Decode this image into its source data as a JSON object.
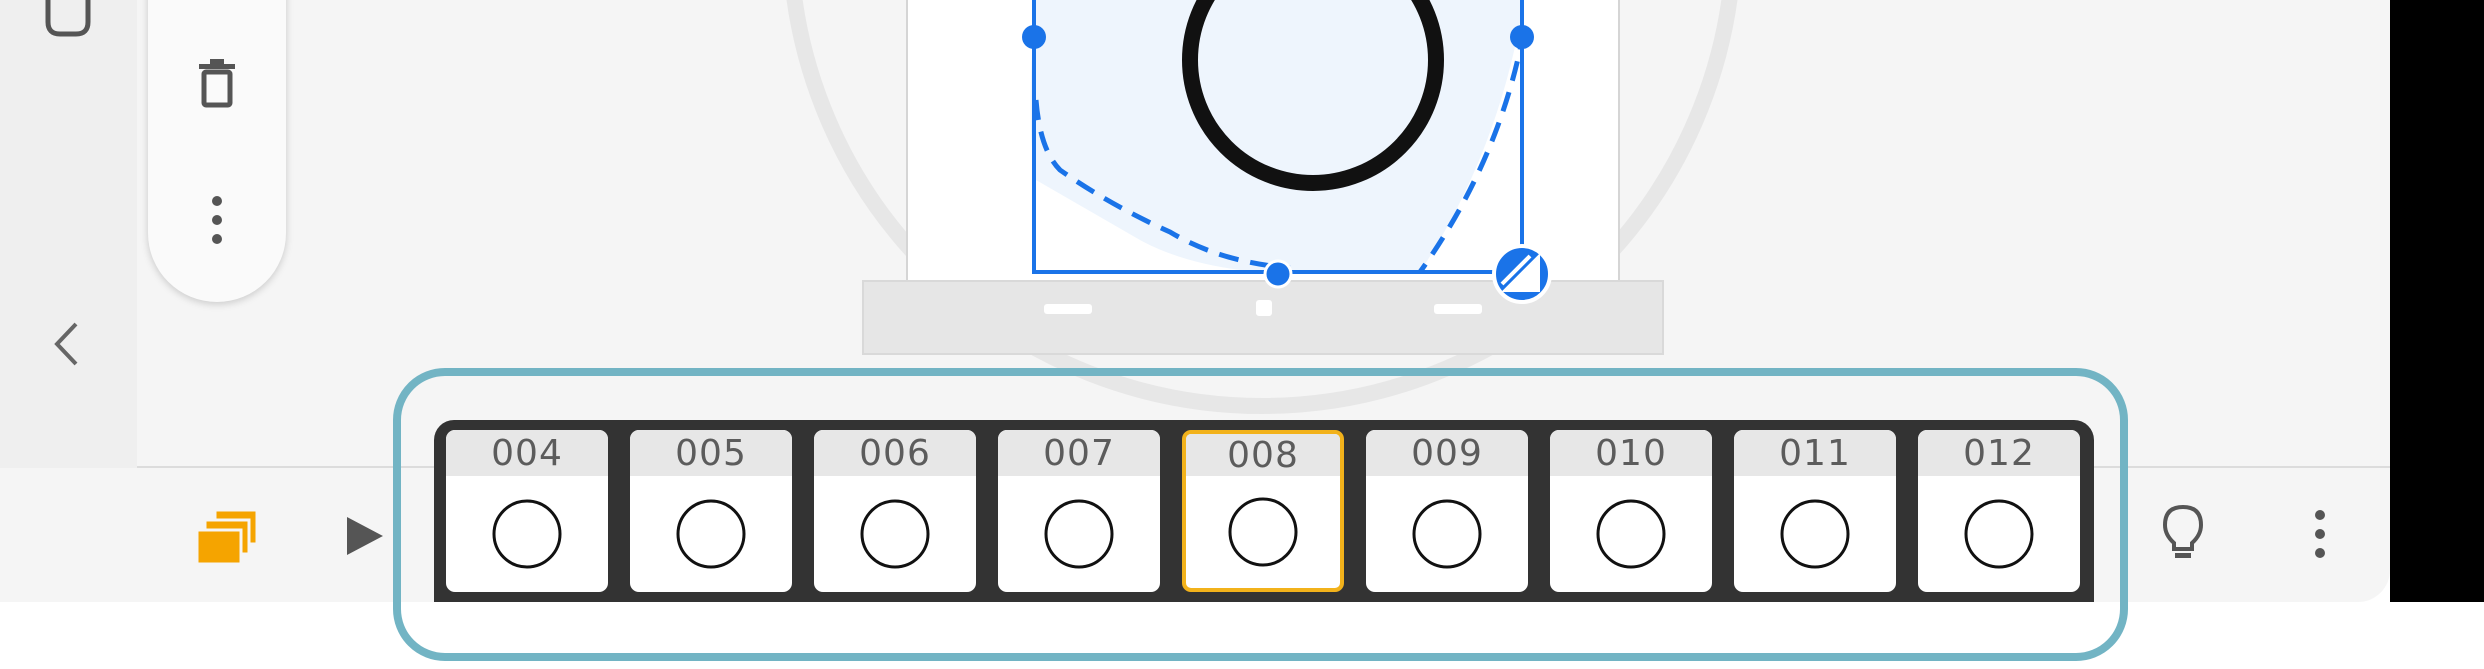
{
  "colors": {
    "accent_blue": "#1a73e8",
    "selection_fill": "#eef5fd",
    "frame_selected_border": "#f2b21b",
    "highlight_outline": "#72b4c4",
    "strip_background": "#333333",
    "layers_icon": "#f5a400"
  },
  "left_panel": {
    "icons": [
      "square-icon",
      "trash-icon",
      "more-vertical-icon",
      "chevron-left-icon"
    ]
  },
  "canvas": {
    "selection_handles": [
      "top-left",
      "top-right",
      "bottom-center",
      "bottom-right-transform"
    ]
  },
  "bottom_bar": {
    "icons": [
      "layers-icon",
      "play-icon",
      "lightbulb-icon",
      "more-vertical-icon"
    ]
  },
  "frames": [
    {
      "label": "004"
    },
    {
      "label": "005"
    },
    {
      "label": "006"
    },
    {
      "label": "007"
    },
    {
      "label": "008",
      "selected": true
    },
    {
      "label": "009"
    },
    {
      "label": "010"
    },
    {
      "label": "011"
    },
    {
      "label": "012"
    }
  ]
}
